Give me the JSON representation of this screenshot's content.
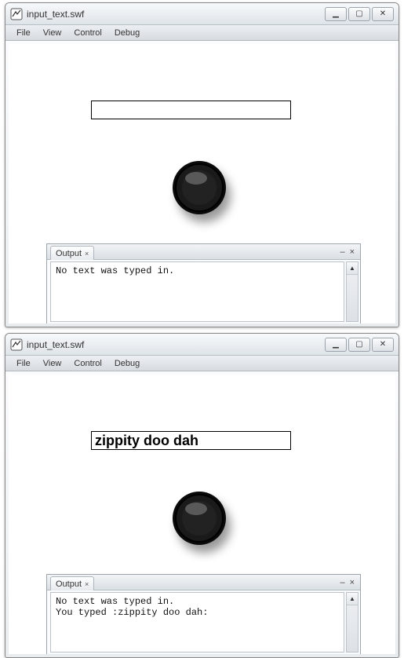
{
  "windows": [
    {
      "title": "input_text.swf",
      "menu": {
        "file": "File",
        "view": "View",
        "control": "Control",
        "debug": "Debug"
      },
      "input_value": "",
      "output": {
        "tab_label": "Output",
        "close_glyph": "×",
        "minimize_glyph": "–",
        "close_panel_glyph": "×",
        "lines": "No text was typed in."
      }
    },
    {
      "title": "input_text.swf",
      "menu": {
        "file": "File",
        "view": "View",
        "control": "Control",
        "debug": "Debug"
      },
      "input_value": "zippity doo dah",
      "output": {
        "tab_label": "Output",
        "close_glyph": "×",
        "minimize_glyph": "–",
        "close_panel_glyph": "×",
        "lines": "No text was typed in.\nYou typed :zippity doo dah:"
      }
    }
  ],
  "win_chrome": {
    "min": "▁",
    "max": "▢",
    "close": "✕"
  }
}
